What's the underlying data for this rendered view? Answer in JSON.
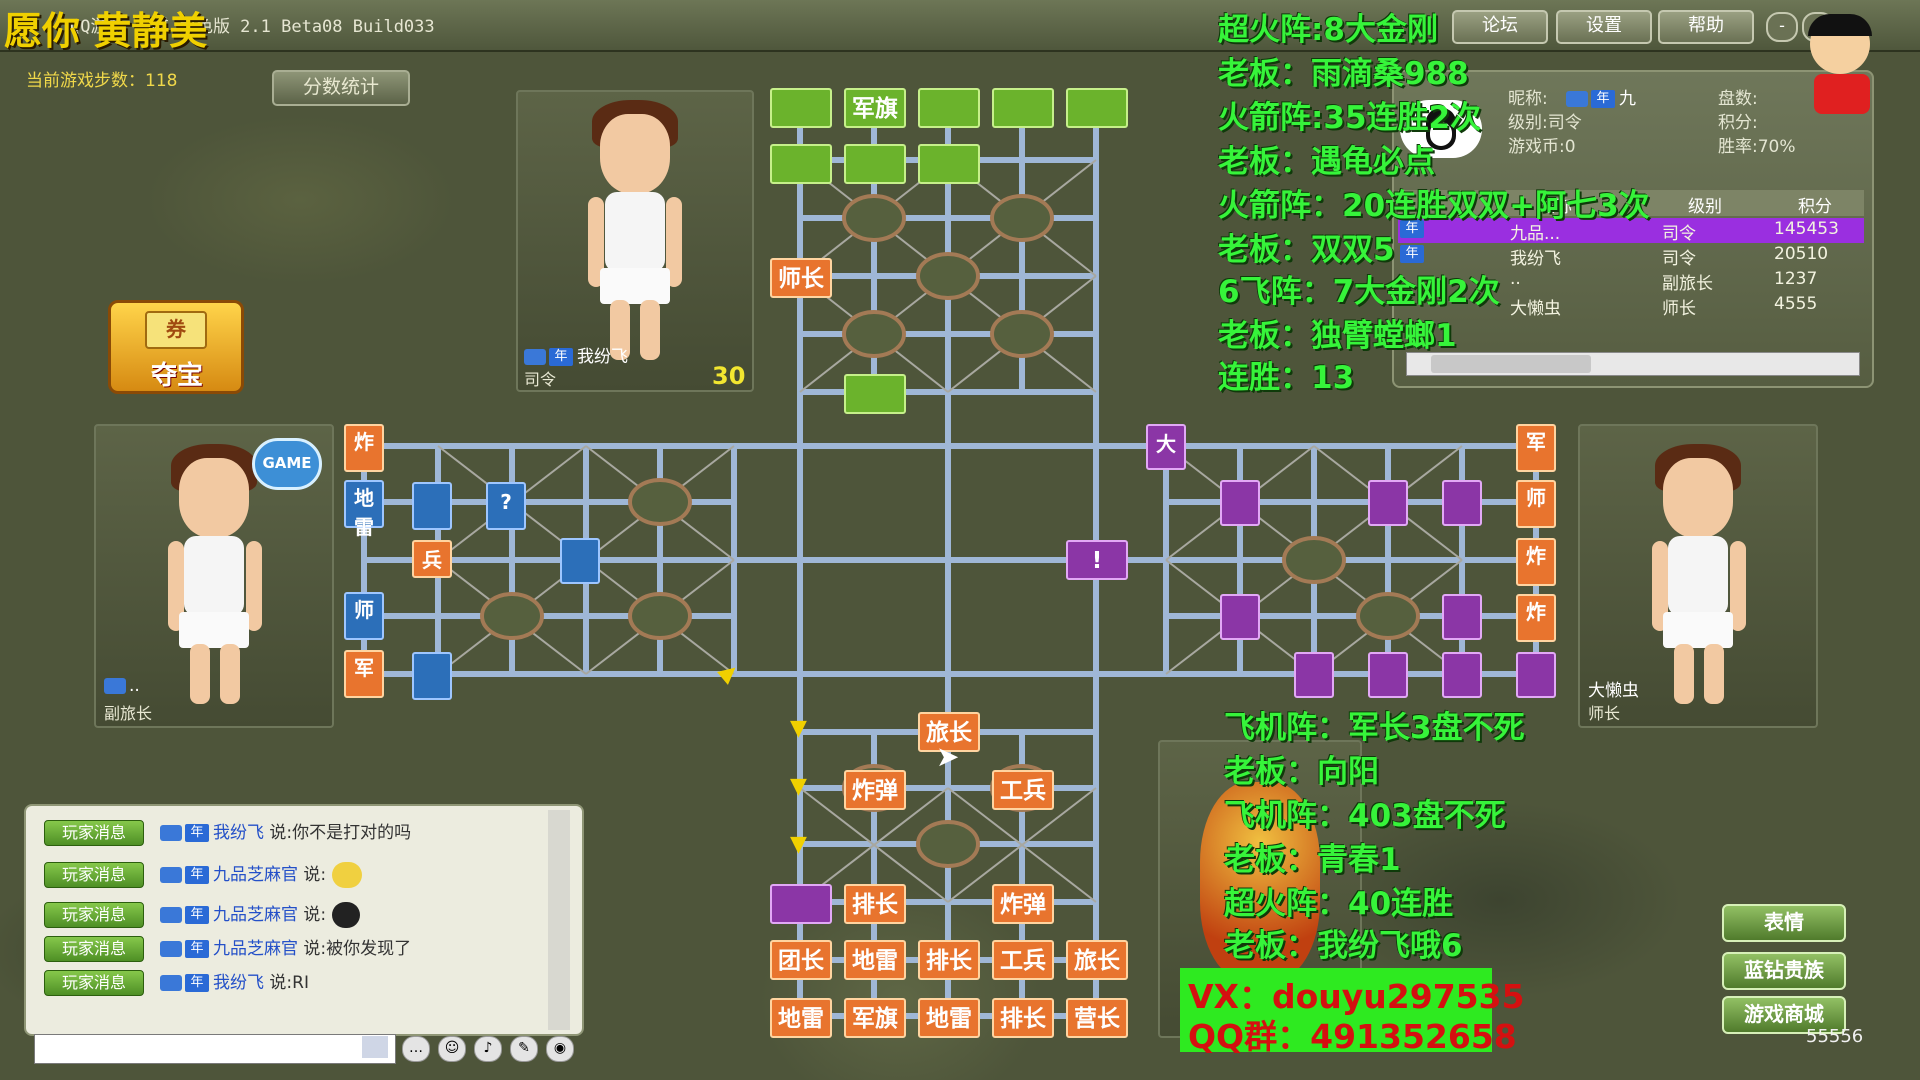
{
  "window": {
    "title": "QQ游戏 军棋 角色版 2.1 Beta08 Build033",
    "buttons": [
      "论坛",
      "设置",
      "帮助"
    ],
    "min": "-",
    "close": "×"
  },
  "stream_banner": "愿你 黄静美",
  "steps_label": "当前游戏步数：118",
  "score_button": "分数统计",
  "treasure_label": "夺宝",
  "treasure_top": "券",
  "players": {
    "top": {
      "name": "我纷飞",
      "year": "年",
      "rank": "司令",
      "timer": "30"
    },
    "left": {
      "name": "..",
      "rank": "副旅长",
      "badge": "GAME"
    },
    "right": {
      "name": "大懒虫",
      "rank": "师长"
    }
  },
  "board": {
    "top_green_row1": [
      "",
      "军旗",
      "",
      "",
      ""
    ],
    "top_green_row2": [
      "",
      "",
      ""
    ],
    "top_green_row5": "",
    "top_orange": "师长",
    "left_vertical": [
      "炸",
      "地雷",
      "",
      "师",
      "军"
    ],
    "left_small": [
      "?",
      "兵"
    ],
    "right_vertical": [
      "军",
      "师",
      "炸",
      "炸"
    ],
    "right_small": "大",
    "center_bang": "!",
    "bottom_rows": [
      [
        "",
        "旅长",
        ""
      ],
      [
        "炸弹",
        "",
        "工兵"
      ],
      [
        "",
        "",
        ""
      ],
      [
        "",
        "排长",
        "",
        "炸弹",
        ""
      ],
      [
        "团长",
        "地雷",
        "排长",
        "工兵",
        "旅长"
      ],
      [
        "地雷",
        "军旗",
        "地雷",
        "排长",
        "营长"
      ]
    ]
  },
  "overlay_top": [
    "超火阵:8大金刚",
    "老板：雨滴桑988",
    "火箭阵:35连胜2次",
    "老板：遇龟必点",
    "火箭阵：20连胜双双+阿七3次",
    "老板：双双5",
    "6飞阵：7大金刚2次",
    "老板：独臂螳螂1",
    "连胜：13"
  ],
  "overlay_bottom": [
    "飞机阵：军长3盘不死",
    "老板：向阳",
    "飞机阵：403盘不死",
    "老板：青春1",
    "超火阵：40连胜",
    "老板：我纷飞哦6"
  ],
  "contact": {
    "vx": "VX：douyu297535",
    "qq": "QQ群：491352658"
  },
  "profile": {
    "nick_label": "昵称:",
    "nick_value": "九",
    "level_label": "级别:",
    "level_value": "司令",
    "coins_label": "游戏币:",
    "coins_value": "0",
    "games_label": "盘数:",
    "score_label": "积分:",
    "winrate_label": "胜率:",
    "winrate_value": "70%"
  },
  "player_table": {
    "headers": [
      "昵称",
      "级别",
      "积分"
    ],
    "rows": [
      {
        "name": "九品...",
        "level": "司令",
        "score": "145453"
      },
      {
        "name": "我纷飞",
        "level": "司令",
        "score": "20510"
      },
      {
        "name": "..",
        "level": "副旅长",
        "score": "1237"
      },
      {
        "name": "大懒虫",
        "level": "师长",
        "score": "4555"
      }
    ]
  },
  "chat": [
    {
      "badge": "玩家消息",
      "name": "我纷飞",
      "says": "说:你不是打对的吗"
    },
    {
      "badge": "玩家消息",
      "name": "九品芝麻官",
      "says": "说:"
    },
    {
      "badge": "玩家消息",
      "name": "九品芝麻官",
      "says": "说:"
    },
    {
      "badge": "玩家消息",
      "name": "九品芝麻官",
      "says": "说:被你发现了"
    },
    {
      "badge": "玩家消息",
      "name": "我纷飞",
      "says": "说:RI"
    }
  ],
  "side_buttons": [
    "表情",
    "蓝钻贵族",
    "游戏商城"
  ],
  "bottom_number": "55556",
  "colors": {
    "overlay_green": "#36f43a",
    "green_piece": "#6bb32c",
    "orange_piece": "#e8742e",
    "blue_piece": "#2c6fb9",
    "purple_piece": "#8b36a6"
  }
}
